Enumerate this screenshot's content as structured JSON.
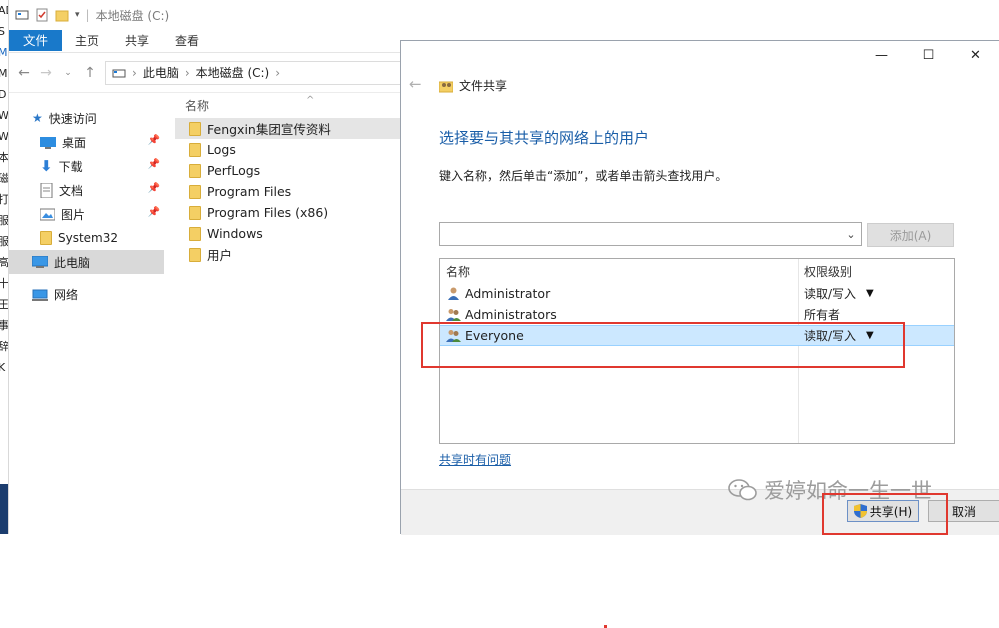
{
  "background_strip": {
    "chars": [
      "AD",
      "S",
      "M",
      "M",
      "D",
      "W",
      "W",
      "本",
      "磁",
      "打",
      "服",
      "服",
      "高",
      "十",
      "王",
      "事",
      "辞",
      "K"
    ]
  },
  "explorer": {
    "title": "本地磁盘 (C:)",
    "ribbon_tabs": [
      "文件",
      "主页",
      "共享",
      "查看"
    ],
    "address_path": [
      "此电脑",
      "本地磁盘 (C:)"
    ],
    "nav_items": [
      {
        "label": "快速访问",
        "icon": "star-icon",
        "pinned": false
      },
      {
        "label": "桌面",
        "icon": "desktop-icon",
        "pinned": true
      },
      {
        "label": "下载",
        "icon": "download-icon",
        "pinned": true
      },
      {
        "label": "文档",
        "icon": "document-icon",
        "pinned": true
      },
      {
        "label": "图片",
        "icon": "picture-icon",
        "pinned": true
      },
      {
        "label": "System32",
        "icon": "folder-icon",
        "pinned": false
      },
      {
        "label": "此电脑",
        "icon": "computer-icon",
        "pinned": false
      },
      {
        "label": "网络",
        "icon": "network-icon",
        "pinned": false
      }
    ],
    "column_header": "名称",
    "files": [
      "Fengxin集团宣传资料",
      "Logs",
      "PerfLogs",
      "Program Files",
      "Program Files (x86)",
      "Windows",
      "用户"
    ]
  },
  "dialog": {
    "window_title": "文件共享",
    "heading": "选择要与其共享的网络上的用户",
    "instruction": "键入名称，然后单击“添加”，或者单击箭头查找用户。",
    "name_value": "",
    "add_label": "添加(A)",
    "col_name": "名称",
    "col_permission": "权限级别",
    "users": [
      {
        "name": "Administrator",
        "permission": "读取/写入",
        "dropdown": true
      },
      {
        "name": "Administrators",
        "permission": "所有者",
        "dropdown": false
      },
      {
        "name": "Everyone",
        "permission": "读取/写入",
        "dropdown": true
      }
    ],
    "trouble_link": "共享时有问题",
    "share_label": "共享(H)",
    "cancel_label": "取消"
  },
  "watermark": "爱婷如命一生一世",
  "colors": {
    "accent": "#1979ca",
    "link": "#1a5ea8",
    "highlight": "#e0382f",
    "selection": "#cce8ff"
  }
}
